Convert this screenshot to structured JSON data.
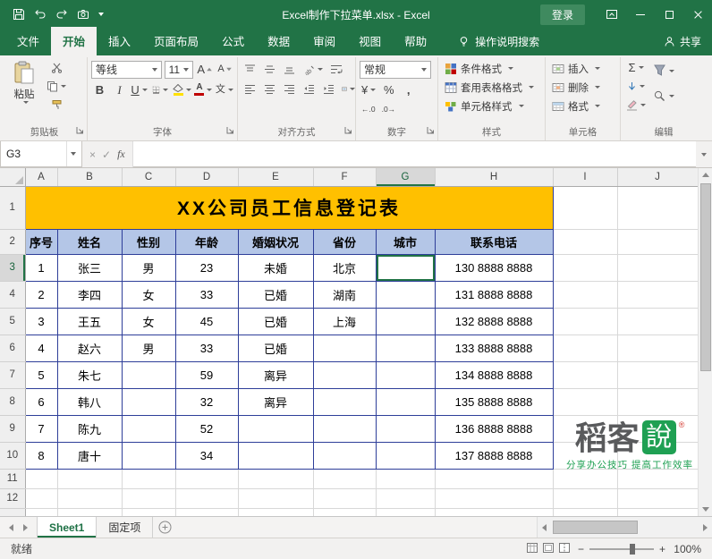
{
  "titlebar": {
    "title": "Excel制作下拉菜单.xlsx  -  Excel",
    "login_label": "登录"
  },
  "ribbon": {
    "tabs": [
      {
        "label": "文件",
        "active": false
      },
      {
        "label": "开始",
        "active": true
      },
      {
        "label": "插入",
        "active": false
      },
      {
        "label": "页面布局",
        "active": false
      },
      {
        "label": "公式",
        "active": false
      },
      {
        "label": "数据",
        "active": false
      },
      {
        "label": "审阅",
        "active": false
      },
      {
        "label": "视图",
        "active": false
      },
      {
        "label": "帮助",
        "active": false
      }
    ],
    "tell_me_label": "操作说明搜索",
    "share_label": "共享",
    "clipboard": {
      "group_label": "剪贴板",
      "paste_label": "粘贴"
    },
    "font": {
      "group_label": "字体",
      "font_name": "等线",
      "font_size": "11"
    },
    "alignment": {
      "group_label": "对齐方式"
    },
    "number": {
      "group_label": "数字",
      "format": "常规"
    },
    "styles": {
      "group_label": "样式",
      "items": [
        "条件格式",
        "套用表格格式",
        "单元格样式"
      ]
    },
    "cells": {
      "group_label": "单元格",
      "items": [
        "插入",
        "删除",
        "格式"
      ]
    },
    "editing": {
      "group_label": "编辑"
    }
  },
  "formula_bar": {
    "name_box": "G3",
    "formula": ""
  },
  "grid": {
    "columns": [
      "A",
      "B",
      "C",
      "D",
      "E",
      "F",
      "G",
      "H",
      "I",
      "J"
    ],
    "row_numbers": [
      "1",
      "2",
      "3",
      "4",
      "5",
      "6",
      "7",
      "8",
      "9",
      "10",
      "11",
      "12"
    ],
    "title": "XX公司员工信息登记表",
    "headers": [
      "序号",
      "姓名",
      "性别",
      "年龄",
      "婚姻状况",
      "省份",
      "城市",
      "联系电话"
    ],
    "rows": [
      [
        "1",
        "张三",
        "男",
        "23",
        "未婚",
        "北京",
        "",
        "130 8888 8888"
      ],
      [
        "2",
        "李四",
        "女",
        "33",
        "已婚",
        "湖南",
        "",
        "131 8888 8888"
      ],
      [
        "3",
        "王五",
        "女",
        "45",
        "已婚",
        "上海",
        "",
        "132 8888 8888"
      ],
      [
        "4",
        "赵六",
        "男",
        "33",
        "已婚",
        "",
        "",
        "133 8888 8888"
      ],
      [
        "5",
        "朱七",
        "",
        "59",
        "离异",
        "",
        "",
        "134 8888 8888"
      ],
      [
        "6",
        "韩八",
        "",
        "32",
        "离异",
        "",
        "",
        "135 8888 8888"
      ],
      [
        "7",
        "陈九",
        "",
        "52",
        "",
        "",
        "",
        "136 8888 8888"
      ],
      [
        "8",
        "唐十",
        "",
        "34",
        "",
        "",
        "",
        "137 8888 8888"
      ]
    ],
    "selected_cell": "G3"
  },
  "sheet_tabs": [
    {
      "label": "Sheet1",
      "active": true
    },
    {
      "label": "固定项",
      "active": false
    }
  ],
  "status_bar": {
    "ready_label": "就绪",
    "zoom_label": "100%"
  },
  "watermark": {
    "text_prefix": "稻客",
    "text_boxed": "說",
    "reg_mark": "®",
    "caption": "分享办公技巧  提高工作效率"
  },
  "icons": {
    "bold": "B",
    "italic": "I",
    "underline": "U",
    "sigma": "Σ",
    "currency": "¥",
    "percent": "%",
    "comma": ",",
    "inc_decimal": "←.0",
    "dec_decimal": ".0→",
    "wrap": "ab",
    "orientation": "ab",
    "phonetic": "文",
    "font_grow": "A",
    "font_shrink": "A",
    "fx": "fx",
    "cancel": "×",
    "enter": "✓",
    "minus": "−",
    "plus": "+"
  },
  "colors": {
    "excel_green": "#217346",
    "title_fill": "#FFC000",
    "header_fill": "#B4C6E7",
    "table_border": "#2E3E99",
    "login_bg": "#3F8A5F",
    "watermark_green": "#1FA053"
  }
}
